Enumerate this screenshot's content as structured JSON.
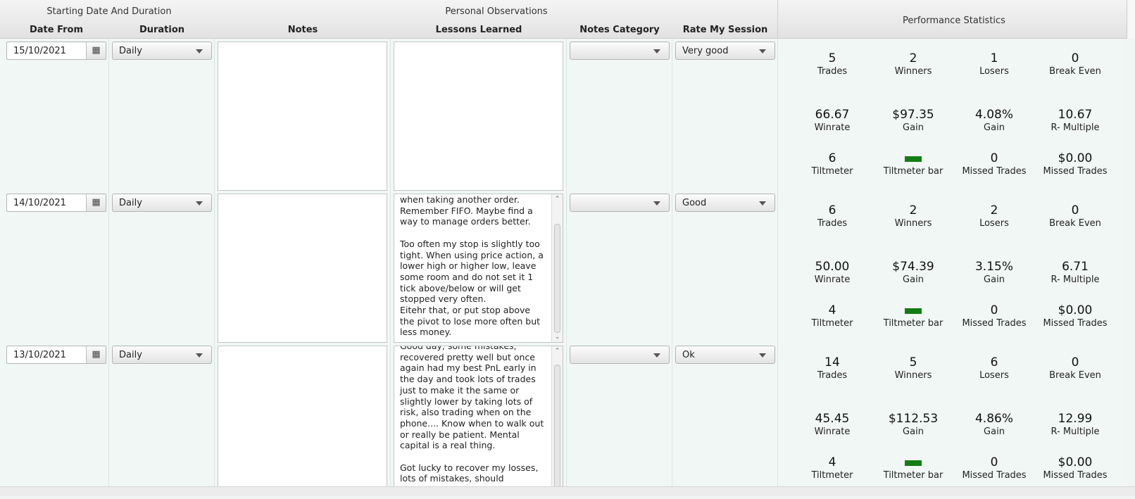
{
  "header": {
    "group1": "Starting Date And Duration",
    "group2": "Personal Observations",
    "group3": "Performance Statistics",
    "columns": {
      "date_from": "Date From",
      "duration": "Duration",
      "notes": "Notes",
      "lessons": "Lessons Learned",
      "category": "Notes Category",
      "rate": "Rate My Session"
    }
  },
  "icons": {
    "calendar": "calendar-icon",
    "dropdown": "chevron-down-icon",
    "scroll_up": "scroll-up-icon",
    "scroll_down": "scroll-down-icon"
  },
  "colors": {
    "tiltbar": "#127d12",
    "body": "#f1f7f4",
    "header": "#e8e8e8"
  },
  "stat_labels": {
    "trades": "Trades",
    "winners": "Winners",
    "losers": "Losers",
    "break_even": "Break Even",
    "winrate": "Winrate",
    "gain_usd": "Gain",
    "gain_pct": "Gain",
    "r_multiple": "R- Multiple",
    "tiltmeter": "Tiltmeter",
    "tiltmeter_bar": "Tiltmeter bar",
    "missed_trades": "Missed Trades",
    "missed_trades_usd": "Missed Trades"
  },
  "rows": [
    {
      "date": "15/10/2021",
      "duration": "Daily",
      "notes": "",
      "lessons": "",
      "category": "",
      "rate": "Very good",
      "stats": {
        "trades": "5",
        "winners": "2",
        "losers": "1",
        "break_even": "0",
        "winrate": "66.67",
        "gain_usd": "$97.35",
        "gain_pct": "4.08%",
        "r_multiple": "10.67",
        "tiltmeter": "6",
        "missed_trades": "0",
        "missed_trades_usd": "$0.00"
      }
    },
    {
      "date": "14/10/2021",
      "duration": "Daily",
      "notes": "",
      "lessons": "when taking another order.\nRemember FIFO. Maybe find a\nway to manage orders better.\n\nToo often my stop is slightly too\ntight. When using price action, a\nlower high or higher low, leave\nsome room and do not set it 1\ntick above/below or will get\nstopped very often.\nEitehr that, or put stop above\nthe pivot to lose more often but\nless money.",
      "category": "",
      "rate": "Good",
      "stats": {
        "trades": "6",
        "winners": "2",
        "losers": "2",
        "break_even": "0",
        "winrate": "50.00",
        "gain_usd": "$74.39",
        "gain_pct": "3.15%",
        "r_multiple": "6.71",
        "tiltmeter": "4",
        "missed_trades": "0",
        "missed_trades_usd": "$0.00"
      }
    },
    {
      "date": "13/10/2021",
      "duration": "Daily",
      "notes": "",
      "lessons": "Good day, some mistakes,\nrecovered pretty well but once\nagain had my best PnL early in\nthe day and took lots of trades\njust to make it the same or\nslightly lower by taking lots of\nrisk, also trading when on the\nphone.... Know when to walk out\nor really be patient. Mental\ncapital is a real thing.\n\nGot lucky to recover my losses,\nlots of mistakes, should",
      "category": "",
      "rate": "Ok",
      "stats": {
        "trades": "14",
        "winners": "5",
        "losers": "6",
        "break_even": "0",
        "winrate": "45.45",
        "gain_usd": "$112.53",
        "gain_pct": "4.86%",
        "r_multiple": "12.99",
        "tiltmeter": "4",
        "missed_trades": "0",
        "missed_trades_usd": "$0.00"
      }
    }
  ]
}
